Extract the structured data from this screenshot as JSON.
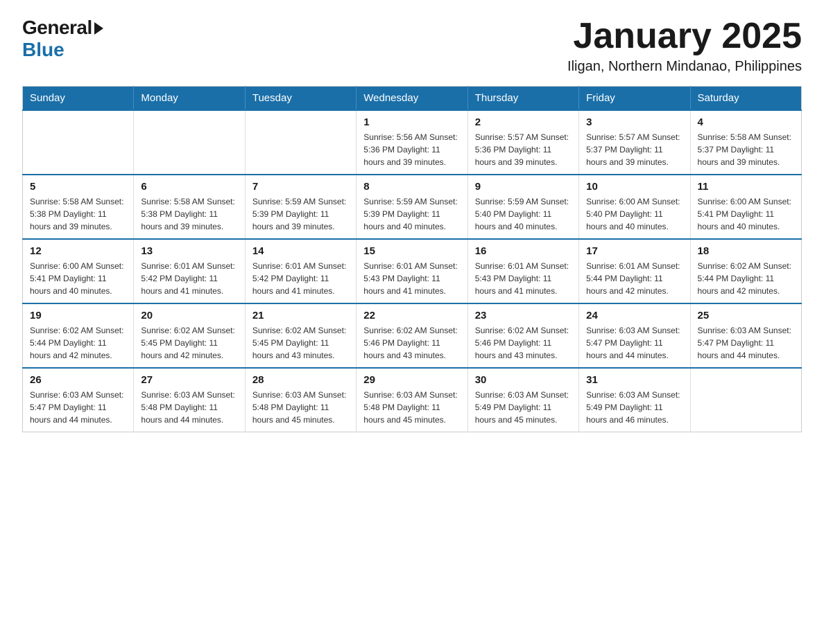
{
  "header": {
    "logo_general": "General",
    "logo_blue": "Blue",
    "month_title": "January 2025",
    "location": "Iligan, Northern Mindanao, Philippines"
  },
  "days_of_week": [
    "Sunday",
    "Monday",
    "Tuesday",
    "Wednesday",
    "Thursday",
    "Friday",
    "Saturday"
  ],
  "weeks": [
    [
      {
        "day": "",
        "info": ""
      },
      {
        "day": "",
        "info": ""
      },
      {
        "day": "",
        "info": ""
      },
      {
        "day": "1",
        "info": "Sunrise: 5:56 AM\nSunset: 5:36 PM\nDaylight: 11 hours and 39 minutes."
      },
      {
        "day": "2",
        "info": "Sunrise: 5:57 AM\nSunset: 5:36 PM\nDaylight: 11 hours and 39 minutes."
      },
      {
        "day": "3",
        "info": "Sunrise: 5:57 AM\nSunset: 5:37 PM\nDaylight: 11 hours and 39 minutes."
      },
      {
        "day": "4",
        "info": "Sunrise: 5:58 AM\nSunset: 5:37 PM\nDaylight: 11 hours and 39 minutes."
      }
    ],
    [
      {
        "day": "5",
        "info": "Sunrise: 5:58 AM\nSunset: 5:38 PM\nDaylight: 11 hours and 39 minutes."
      },
      {
        "day": "6",
        "info": "Sunrise: 5:58 AM\nSunset: 5:38 PM\nDaylight: 11 hours and 39 minutes."
      },
      {
        "day": "7",
        "info": "Sunrise: 5:59 AM\nSunset: 5:39 PM\nDaylight: 11 hours and 39 minutes."
      },
      {
        "day": "8",
        "info": "Sunrise: 5:59 AM\nSunset: 5:39 PM\nDaylight: 11 hours and 40 minutes."
      },
      {
        "day": "9",
        "info": "Sunrise: 5:59 AM\nSunset: 5:40 PM\nDaylight: 11 hours and 40 minutes."
      },
      {
        "day": "10",
        "info": "Sunrise: 6:00 AM\nSunset: 5:40 PM\nDaylight: 11 hours and 40 minutes."
      },
      {
        "day": "11",
        "info": "Sunrise: 6:00 AM\nSunset: 5:41 PM\nDaylight: 11 hours and 40 minutes."
      }
    ],
    [
      {
        "day": "12",
        "info": "Sunrise: 6:00 AM\nSunset: 5:41 PM\nDaylight: 11 hours and 40 minutes."
      },
      {
        "day": "13",
        "info": "Sunrise: 6:01 AM\nSunset: 5:42 PM\nDaylight: 11 hours and 41 minutes."
      },
      {
        "day": "14",
        "info": "Sunrise: 6:01 AM\nSunset: 5:42 PM\nDaylight: 11 hours and 41 minutes."
      },
      {
        "day": "15",
        "info": "Sunrise: 6:01 AM\nSunset: 5:43 PM\nDaylight: 11 hours and 41 minutes."
      },
      {
        "day": "16",
        "info": "Sunrise: 6:01 AM\nSunset: 5:43 PM\nDaylight: 11 hours and 41 minutes."
      },
      {
        "day": "17",
        "info": "Sunrise: 6:01 AM\nSunset: 5:44 PM\nDaylight: 11 hours and 42 minutes."
      },
      {
        "day": "18",
        "info": "Sunrise: 6:02 AM\nSunset: 5:44 PM\nDaylight: 11 hours and 42 minutes."
      }
    ],
    [
      {
        "day": "19",
        "info": "Sunrise: 6:02 AM\nSunset: 5:44 PM\nDaylight: 11 hours and 42 minutes."
      },
      {
        "day": "20",
        "info": "Sunrise: 6:02 AM\nSunset: 5:45 PM\nDaylight: 11 hours and 42 minutes."
      },
      {
        "day": "21",
        "info": "Sunrise: 6:02 AM\nSunset: 5:45 PM\nDaylight: 11 hours and 43 minutes."
      },
      {
        "day": "22",
        "info": "Sunrise: 6:02 AM\nSunset: 5:46 PM\nDaylight: 11 hours and 43 minutes."
      },
      {
        "day": "23",
        "info": "Sunrise: 6:02 AM\nSunset: 5:46 PM\nDaylight: 11 hours and 43 minutes."
      },
      {
        "day": "24",
        "info": "Sunrise: 6:03 AM\nSunset: 5:47 PM\nDaylight: 11 hours and 44 minutes."
      },
      {
        "day": "25",
        "info": "Sunrise: 6:03 AM\nSunset: 5:47 PM\nDaylight: 11 hours and 44 minutes."
      }
    ],
    [
      {
        "day": "26",
        "info": "Sunrise: 6:03 AM\nSunset: 5:47 PM\nDaylight: 11 hours and 44 minutes."
      },
      {
        "day": "27",
        "info": "Sunrise: 6:03 AM\nSunset: 5:48 PM\nDaylight: 11 hours and 44 minutes."
      },
      {
        "day": "28",
        "info": "Sunrise: 6:03 AM\nSunset: 5:48 PM\nDaylight: 11 hours and 45 minutes."
      },
      {
        "day": "29",
        "info": "Sunrise: 6:03 AM\nSunset: 5:48 PM\nDaylight: 11 hours and 45 minutes."
      },
      {
        "day": "30",
        "info": "Sunrise: 6:03 AM\nSunset: 5:49 PM\nDaylight: 11 hours and 45 minutes."
      },
      {
        "day": "31",
        "info": "Sunrise: 6:03 AM\nSunset: 5:49 PM\nDaylight: 11 hours and 46 minutes."
      },
      {
        "day": "",
        "info": ""
      }
    ]
  ]
}
